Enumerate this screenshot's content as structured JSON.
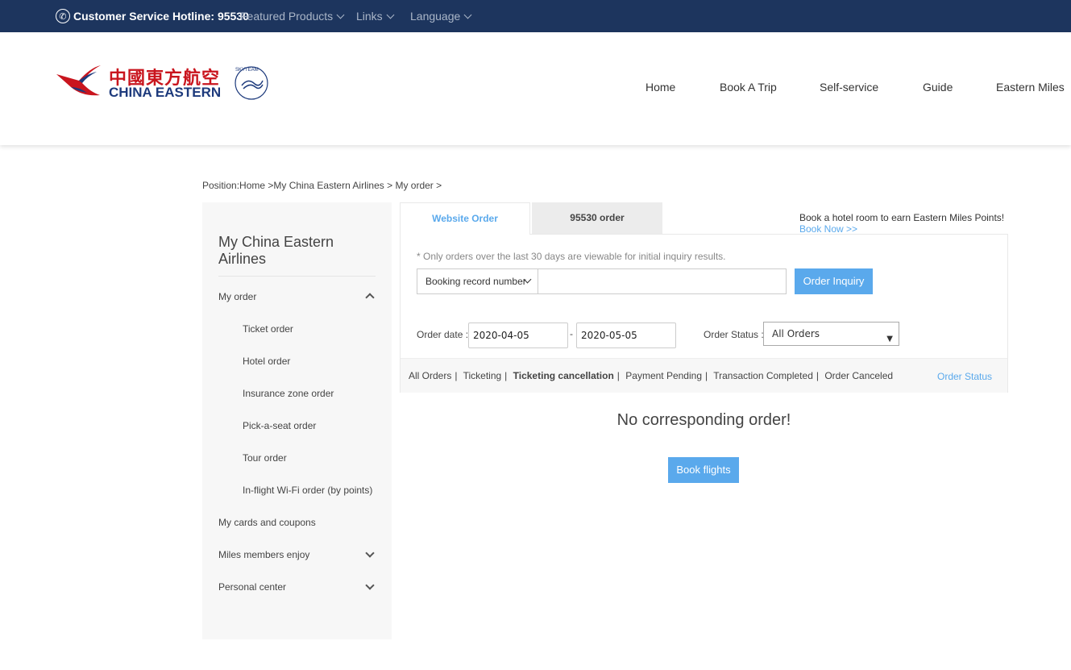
{
  "topbar": {
    "hotline": "Customer Service Hotline: 95530",
    "menus": [
      "Featured Products",
      "Links",
      "Language"
    ]
  },
  "logo": {
    "chinese": "中國東方航空",
    "english": "CHINA EASTERN",
    "skyteam": "SKYTEAM"
  },
  "nav": [
    "Home",
    "Book A Trip",
    "Self-service",
    "Guide",
    "Eastern Miles"
  ],
  "breadcrumb": "Position:Home >My China Eastern Airlines > My order >",
  "sidebar": {
    "title": "My China Eastern Airlines",
    "items": [
      {
        "label": "My order"
      },
      {
        "label": "Ticket order"
      },
      {
        "label": "Hotel order"
      },
      {
        "label": "Insurance zone order"
      },
      {
        "label": "Pick-a-seat order"
      },
      {
        "label": "Tour order"
      },
      {
        "label": "In-flight Wi-Fi order (by points)"
      },
      {
        "label": "My cards and coupons"
      },
      {
        "label": "Miles members enjoy"
      },
      {
        "label": "Personal center"
      }
    ]
  },
  "tabs": {
    "website": "Website Order",
    "hotline": "95530 order"
  },
  "promo": {
    "text": "Book a hotel room to earn Eastern Miles Points!",
    "link": "Book Now >>"
  },
  "search": {
    "note": "* Only orders over the last 30 days are viewable for initial inquiry results.",
    "type_value": "Booking record number",
    "input_value": "",
    "button": "Order Inquiry",
    "order_date_label": "Order date :",
    "date_from": "2020-04-05",
    "date_sep": "-",
    "date_to": "2020-05-05",
    "status_label": "Order Status :",
    "status_value": "All Orders"
  },
  "filters": {
    "items": [
      "All Orders",
      "Ticketing",
      "Ticketing cancellation",
      "Payment Pending",
      "Transaction Completed",
      "Order Canceled"
    ],
    "status_link": "Order Status"
  },
  "empty": {
    "message": "No corresponding order!",
    "button": "Book flights"
  },
  "colors": {
    "topbar": "#1d355e",
    "accent": "#5aa9ec",
    "logo_red": "#c9151e",
    "logo_blue": "#1d3a7c"
  }
}
